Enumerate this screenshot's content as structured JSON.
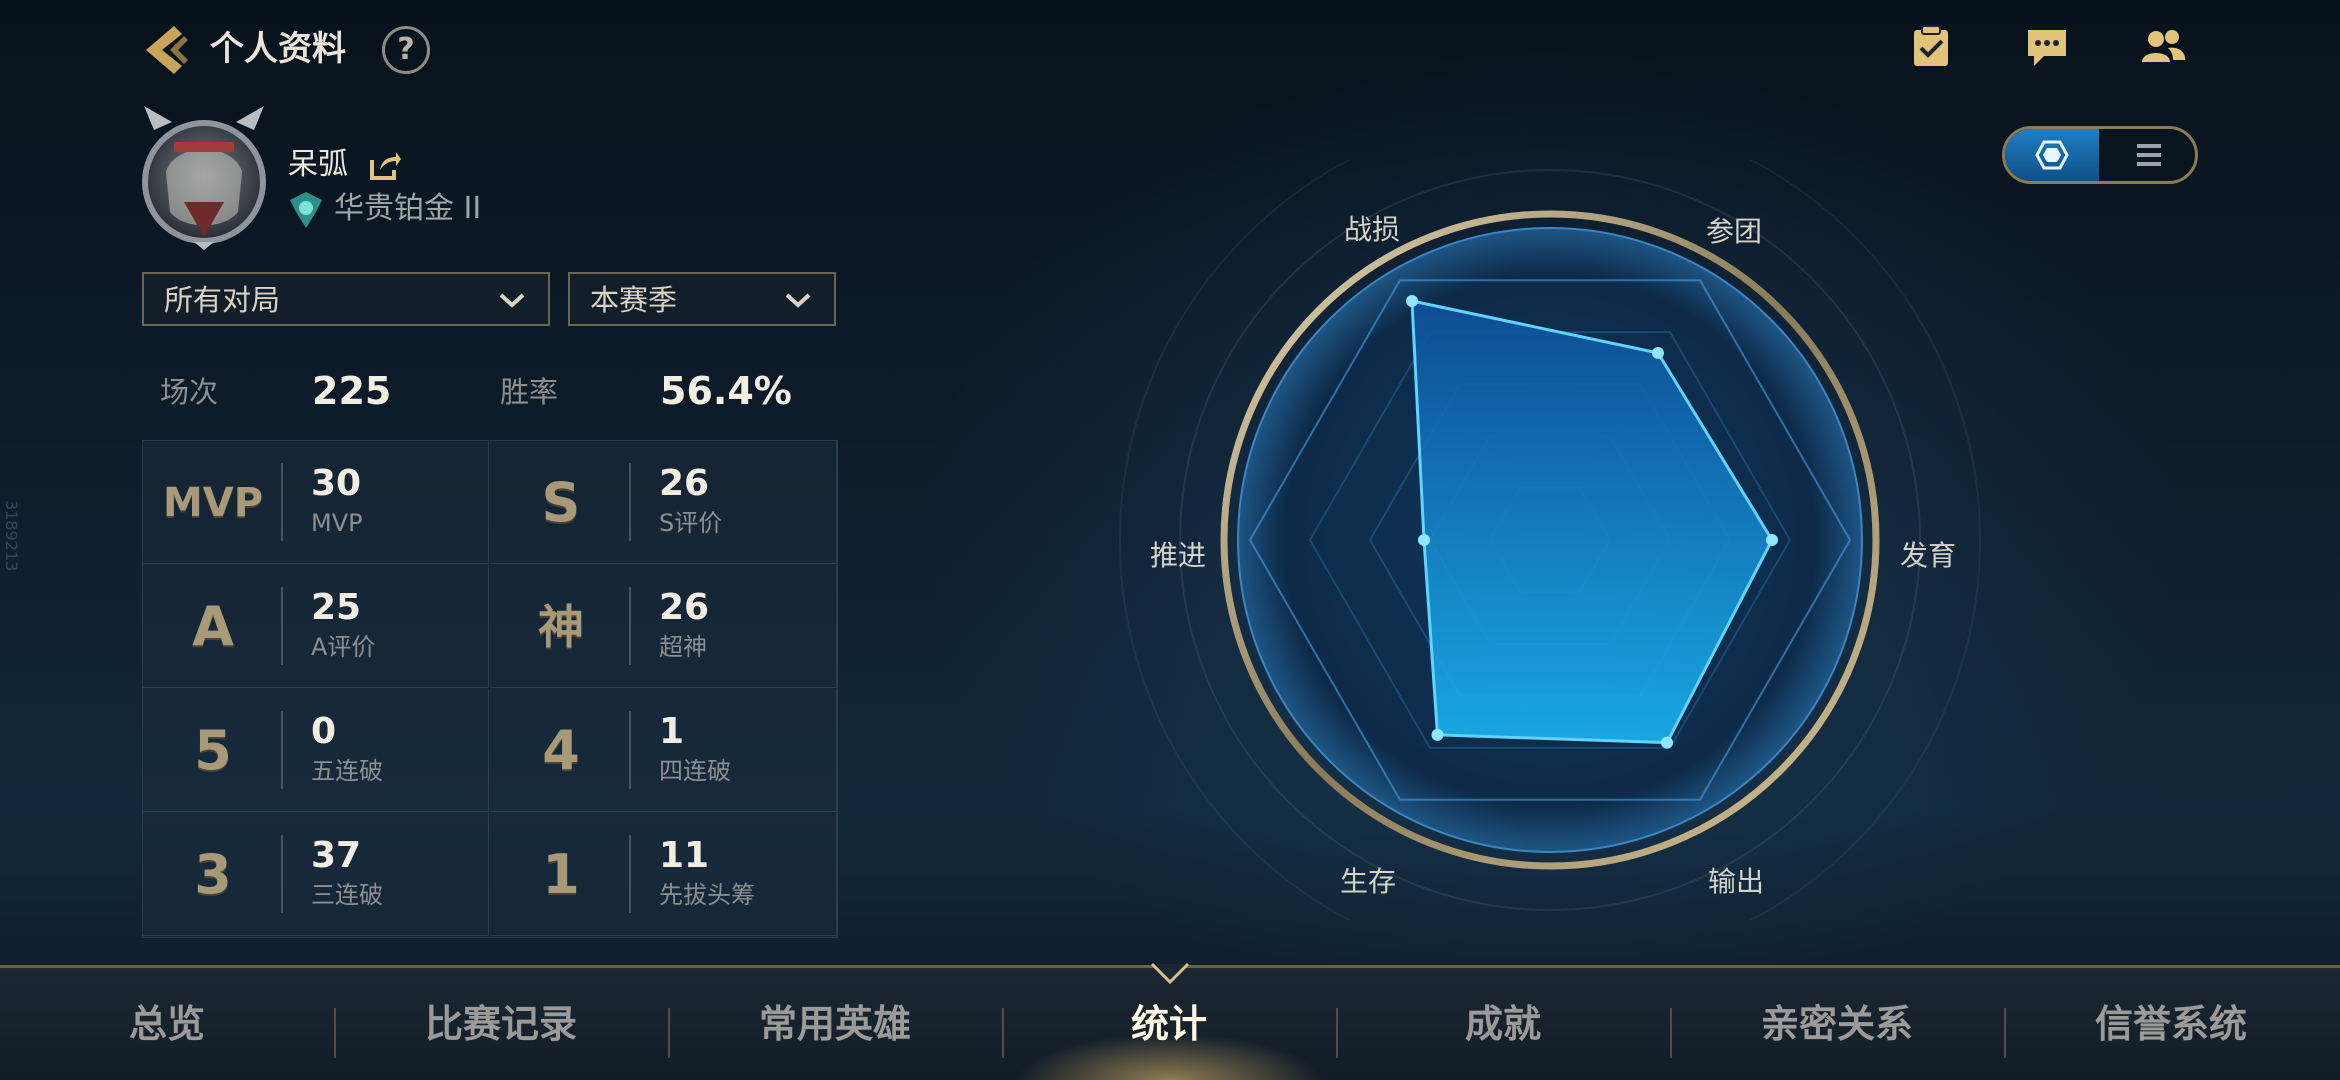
{
  "header": {
    "title": "个人资料",
    "help_glyph": "?",
    "icons": [
      "task-checklist-icon",
      "chat-icon",
      "friends-icon"
    ]
  },
  "profile": {
    "name": "呆弧",
    "rank": "华贵铂金 II"
  },
  "filters": {
    "mode": "所有对局",
    "season": "本赛季"
  },
  "summary": {
    "games_label": "场次",
    "games_value": "225",
    "winrate_label": "胜率",
    "winrate_value": "56.4%"
  },
  "stats": [
    {
      "badge": "MVP",
      "value": "30",
      "label": "MVP"
    },
    {
      "badge": "S",
      "value": "26",
      "label": "S评价"
    },
    {
      "badge": "A",
      "value": "25",
      "label": "A评价"
    },
    {
      "badge": "神",
      "value": "26",
      "label": "超神"
    },
    {
      "badge": "5",
      "value": "0",
      "label": "五连破"
    },
    {
      "badge": "4",
      "value": "1",
      "label": "四连破"
    },
    {
      "badge": "3",
      "value": "37",
      "label": "三连破"
    },
    {
      "badge": "1",
      "value": "11",
      "label": "先拔头筹"
    }
  ],
  "radar": {
    "axes": [
      "战损",
      "参团",
      "发育",
      "输出",
      "生存",
      "推进"
    ],
    "values": [
      0.92,
      0.72,
      0.74,
      0.78,
      0.75,
      0.42
    ]
  },
  "view_toggle": {
    "options": [
      "hexagon-view-icon",
      "list-view-icon"
    ],
    "selected": 0
  },
  "watermark": "3189213",
  "tabs": [
    {
      "label": "总览",
      "active": false
    },
    {
      "label": "比赛记录",
      "active": false
    },
    {
      "label": "常用英雄",
      "active": false
    },
    {
      "label": "统计",
      "active": true
    },
    {
      "label": "成就",
      "active": false
    },
    {
      "label": "亲密关系",
      "active": false
    },
    {
      "label": "信誉系统",
      "active": false
    }
  ],
  "colors": {
    "accent_gold": "#c9a55a",
    "radar_fill": "#1aa8ee",
    "radar_line": "#5fd4ff",
    "background": "#0e1d2c"
  }
}
